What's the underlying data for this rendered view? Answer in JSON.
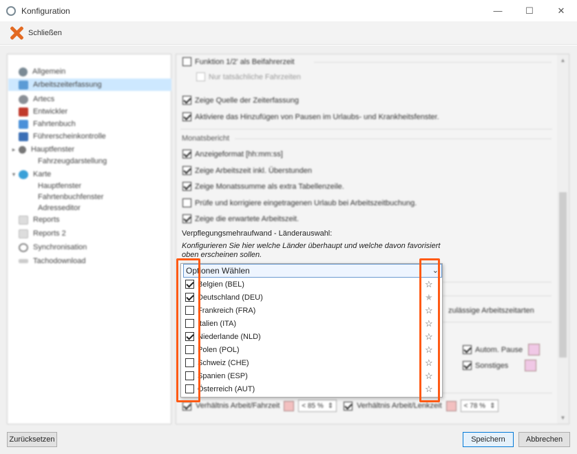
{
  "window": {
    "title": "Konfiguration",
    "minimize_icon": "—",
    "maximize_icon": "☐",
    "close_icon": "✕"
  },
  "toolbar": {
    "close_label": "Schließen"
  },
  "sidebar": {
    "items": [
      {
        "label": "Allgemein",
        "icon_color": "#7a8a95",
        "arrow": ""
      },
      {
        "label": "Arbeitszeiterfassung",
        "icon_color": "#5b9bd5",
        "arrow": ""
      },
      {
        "label": "Artecs",
        "icon_color": "#8a8f96",
        "arrow": ""
      },
      {
        "label": "Entwickler",
        "icon_color": "#c0392b",
        "arrow": ""
      },
      {
        "label": "Fahrtenbuch",
        "icon_color": "#4a90d9",
        "arrow": ""
      },
      {
        "label": "Führerscheinkontrolle",
        "icon_color": "#3b6fb6",
        "arrow": ""
      },
      {
        "label": "Hauptfenster",
        "icon_color": "#777777",
        "arrow": "▸"
      },
      {
        "label": "Fahrzeugdarstellung",
        "icon_color": "",
        "arrow": ""
      },
      {
        "label": "Karte",
        "icon_color": "#3aa0d8",
        "arrow": "▾"
      },
      {
        "label": "Hauptfenster",
        "icon_color": "",
        "arrow": ""
      },
      {
        "label": "Fahrtenbuchfenster",
        "icon_color": "",
        "arrow": ""
      },
      {
        "label": "Adresseditor",
        "icon_color": "",
        "arrow": ""
      },
      {
        "label": "Reports",
        "icon_color": "#bbbbbb",
        "arrow": ""
      },
      {
        "label": "Reports 2",
        "icon_color": "#bbbbbb",
        "arrow": ""
      },
      {
        "label": "Synchronisation",
        "icon_color": "#888888",
        "arrow": ""
      },
      {
        "label": "Tachodownload",
        "icon_color": "#999999",
        "arrow": ""
      }
    ]
  },
  "content": {
    "opt_funktion": "Funktion 1/2' als Beifahrerzeit",
    "opt_nur": "Nur tatsächliche Fahrzeiten",
    "opt_quelle": "Zeige Quelle der Zeiterfassung",
    "opt_pausen": "Aktiviere das Hinzufügen von Pausen im Urlaubs- und Krankheitsfenster.",
    "section_monatsbericht": "Monatsbericht",
    "opt_anzeigeformat": "Anzeigeformat [hh:mm:ss]",
    "opt_ueberstunden": "Zeige Arbeitszeit inkl. Überstunden",
    "opt_monatssumme": "Zeige Monatssumme als extra Tabellenzeile.",
    "opt_urlaub": "Prüfe und korrigiere eingetragenen Urlaub bei Arbeitszeitbuchung.",
    "opt_erwartete": "Zeige die erwartete Arbeitszeit.",
    "verpflegung_label": "Verpflegungsmehraufwand - Länderauswahl:",
    "verpflegung_hint": "Konfigurieren Sie hier welche Länder überhaupt und welche davon favorisiert oben erscheinen sollen.",
    "zulaessige": "zulässige Arbeitszeitarten",
    "autom_pause": "Autom. Pause",
    "sonstiges": "Sonstiges",
    "verhaeltnis_fahrzeit": "Verhältnis Arbeit/Fahrzeit",
    "verhaeltnis_fahrzeit_value": "< 85 %",
    "verhaeltnis_lenkzeit": "Verhältnis Arbeit/Lenkzeit",
    "verhaeltnis_lenkzeit_value": "< 78 %"
  },
  "dropdown": {
    "placeholder": "Optionen Wählen",
    "chevron": "⌄",
    "items": [
      {
        "label": "Belgien (BEL)",
        "checked": true,
        "star": "☆"
      },
      {
        "label": "Deutschland (DEU)",
        "checked": true,
        "star": "★"
      },
      {
        "label": "Frankreich (FRA)",
        "checked": false,
        "star": "☆"
      },
      {
        "label": "Italien (ITA)",
        "checked": false,
        "star": "☆"
      },
      {
        "label": "Niederlande (NLD)",
        "checked": true,
        "star": "☆"
      },
      {
        "label": "Polen (POL)",
        "checked": false,
        "star": "☆"
      },
      {
        "label": "Schweiz (CHE)",
        "checked": false,
        "star": "☆"
      },
      {
        "label": "Spanien (ESP)",
        "checked": false,
        "star": "☆"
      },
      {
        "label": "Österreich (AUT)",
        "checked": false,
        "star": "☆"
      }
    ]
  },
  "footer": {
    "reset": "Zurücksetzen",
    "save": "Speichern",
    "cancel": "Abbrechen"
  },
  "colors": {
    "highlight": "#ff5a14",
    "selected": "#cde8ff",
    "swatch_pink": "#f0c8e6",
    "swatch_red": "#f3c0c0"
  }
}
